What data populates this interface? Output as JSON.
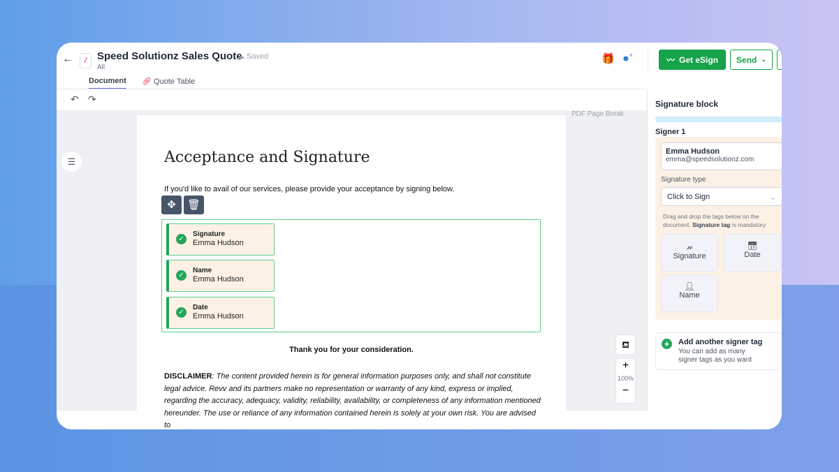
{
  "header": {
    "title": "Speed Solutionz Sales Quote",
    "subtitle": "All",
    "save_status": "Saved",
    "doc_icon": "/",
    "get_esign": "Get eSign",
    "send": "Send"
  },
  "tabs": [
    {
      "label": "Document"
    },
    {
      "label": "Quote Table"
    }
  ],
  "document": {
    "page_break": "PDF Page Break",
    "heading": "Acceptance and Signature",
    "intro": "If you'd like to avail of our services, please provide your acceptance by signing below.",
    "tags": [
      {
        "label": "Signature",
        "value": "Emma Hudson"
      },
      {
        "label": "Name",
        "value": "Emma Hudson"
      },
      {
        "label": "Date",
        "value": "Emma Hudson"
      }
    ],
    "thanks": "Thank you for your consideration.",
    "disclaimer_label": "DISCLAIMER",
    "disclaimer_text": ": The content provided herein is for general information purposes only, and shall not constitute legal advice. Revv and its partners make no representation or warranty of any kind, express or implied, regarding the accuracy, adequacy, validity, reliability, availability, or completeness of any information mentioned hereunder. The use or reliance of any information contained herein is solely at your own risk. You are advised to"
  },
  "zoom": {
    "level": "100%",
    "plus": "+",
    "minus": "−"
  },
  "panel": {
    "title": "Signature block",
    "signer_label": "Signer 1",
    "signer_name": "Emma Hudson",
    "signer_email": "emma@speedsolutionz.com",
    "sig_type_label": "Signature type",
    "sig_type_value": "Click to Sign",
    "hint_pre": "Drag and drop the tags below on the document. ",
    "hint_bold": "Signature tag",
    "hint_post": " is mandatory",
    "tag_buttons": [
      {
        "label": "Signature"
      },
      {
        "label": "Date"
      },
      {
        "label": "Name"
      }
    ],
    "add_title": "Add another signer tag",
    "add_desc": "You can add as many signer tags as you want"
  },
  "colors": {
    "primary": "#16a34a",
    "accent": "#6366f1",
    "tag_bg": "#fdf1e6"
  }
}
